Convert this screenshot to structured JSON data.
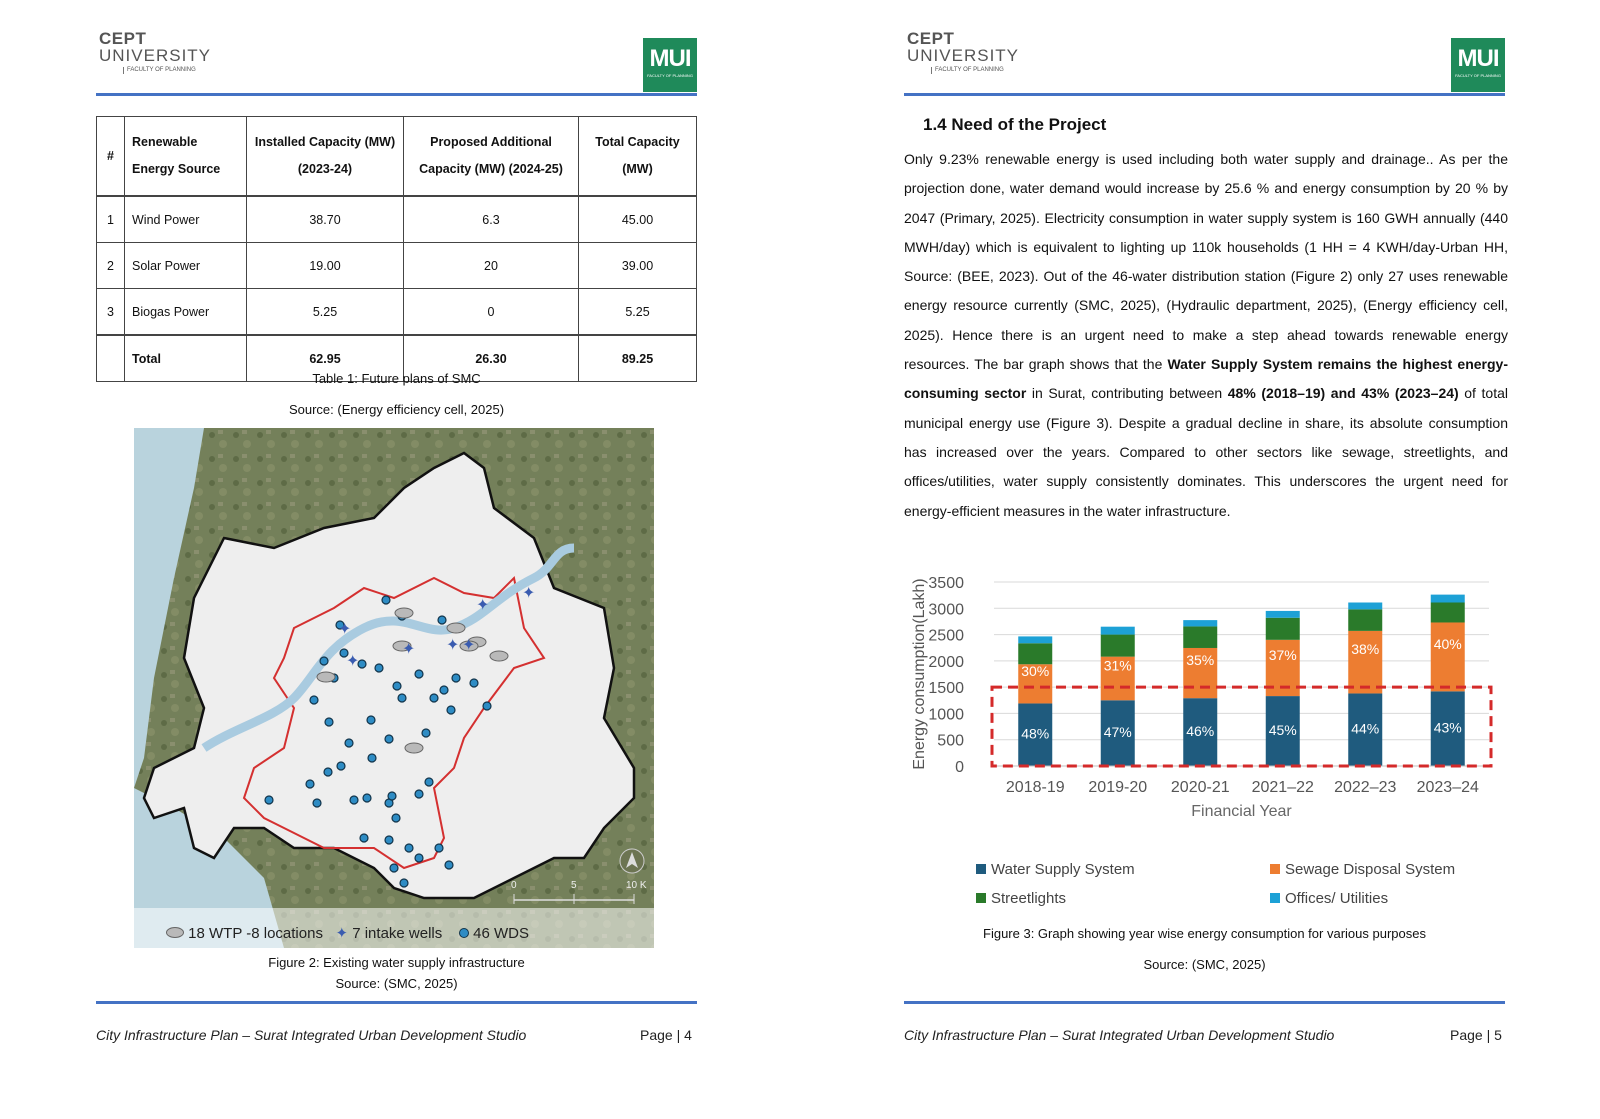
{
  "header": {
    "cept_line1": "CEPT",
    "cept_line2": "UNIVERSITY",
    "cept_line3": "FACULTY OF PLANNING",
    "mui_title": "MUI",
    "mui_sub": "FACULTY OF PLANNING"
  },
  "left": {
    "table": {
      "headers": [
        "#",
        "Renewable Energy Source",
        "Installed Capacity (MW) (2023-24)",
        "Proposed Additional Capacity (MW) (2024-25)",
        "Total Capacity (MW)"
      ],
      "rows": [
        {
          "n": "1",
          "src": "Wind Power",
          "inst": "38.70",
          "prop": "6.3",
          "total": "45.00"
        },
        {
          "n": "2",
          "src": "Solar Power",
          "inst": "19.00",
          "prop": "20",
          "total": "39.00"
        },
        {
          "n": "3",
          "src": "Biogas Power",
          "inst": "5.25",
          "prop": "0",
          "total": "5.25"
        }
      ],
      "total": {
        "label": "Total",
        "inst": "62.95",
        "prop": "26.30",
        "total": "89.25"
      }
    },
    "table_caption": "Table 1: Future plans of SMC",
    "table_source": "Source: (Energy efficiency cell, 2025)",
    "map_legend": {
      "wtp": "18 WTP -8 locations",
      "wells": "7 intake wells",
      "wds": "46 WDS"
    },
    "scale_labels": [
      "0",
      "5",
      "10 K"
    ],
    "figure_caption": "Figure 2: Existing water supply infrastructure",
    "figure_source": "Source: (SMC, 2025)",
    "footer": "City Infrastructure Plan – Surat Integrated Urban Development Studio",
    "page": "Page | 4"
  },
  "right": {
    "section_title": "1.4   Need of the Project",
    "paragraph": [
      {
        "t": "Only 9.23% renewable energy is used including both water supply and drainage.. As per the projection done, water demand would increase by 25.6 % and energy consumption by 20 % by 2047 (Primary, 2025). Electricity consumption in water supply system is 160 GWH annually (440 MWH/day) which is equivalent to lighting up 110k households (1 HH = 4 KWH/day-Urban HH, Source: (BEE, 2023). Out of the 46-water distribution station (Figure 2) only 27 uses renewable energy resource currently (SMC, 2025), (Hydraulic department, 2025), (Energy efficiency cell, 2025). Hence there is an urgent need to make a step ahead towards renewable energy resources. The bar graph shows that the ",
        "b": false
      },
      {
        "t": "Water Supply System remains the highest energy-consuming sector",
        "b": true
      },
      {
        "t": " in Surat, contributing between ",
        "b": false
      },
      {
        "t": "48% (2018–19) and 43% (2023–24)",
        "b": true
      },
      {
        "t": " of total municipal energy use (Figure 3). Despite a gradual decline in share, its absolute consumption has increased over the years. Compared to other sectors like sewage, streetlights, and offices/utilities, water supply consistently dominates. This underscores the urgent need for energy-efficient measures in the water infrastructure.",
        "b": false
      }
    ],
    "figure_caption": "Figure 3: Graph showing year wise energy consumption for various purposes",
    "figure_source": "Source: (SMC, 2025)",
    "footer": "City Infrastructure Plan – Surat Integrated Urban Development Studio",
    "page": "Page | 5"
  },
  "chart_data": {
    "type": "bar",
    "stacked": true,
    "categories": [
      "2018-19",
      "2019-20",
      "2020-21",
      "2021–22",
      "2022–23",
      "2023–24"
    ],
    "series": [
      {
        "name": "Water Supply System",
        "color": "#1f5b7e",
        "values": [
          1190,
          1250,
          1290,
          1330,
          1380,
          1420
        ],
        "labels": [
          "48%",
          "47%",
          "46%",
          "45%",
          "44%",
          "43%"
        ]
      },
      {
        "name": "Sewage Disposal System",
        "color": "#ed7d31",
        "values": [
          745,
          830,
          955,
          1070,
          1190,
          1310
        ],
        "labels": [
          "30%",
          "31%",
          "35%",
          "37%",
          "38%",
          "40%"
        ]
      },
      {
        "name": "Streetlights",
        "color": "#2a7a2a",
        "values": [
          400,
          420,
          410,
          420,
          410,
          380
        ]
      },
      {
        "name": "Offices/ Utilities",
        "color": "#1da1d6",
        "values": [
          130,
          150,
          120,
          130,
          130,
          150
        ]
      }
    ],
    "xlabel": "Financial Year",
    "ylabel": "Energy consumption(Lakh)",
    "ylim": [
      0,
      3500
    ],
    "yticks": [
      0,
      500,
      1000,
      1500,
      2000,
      2500,
      3000,
      3500
    ],
    "highlight_box_value": 1500,
    "legend_position": "bottom",
    "grid": true
  }
}
